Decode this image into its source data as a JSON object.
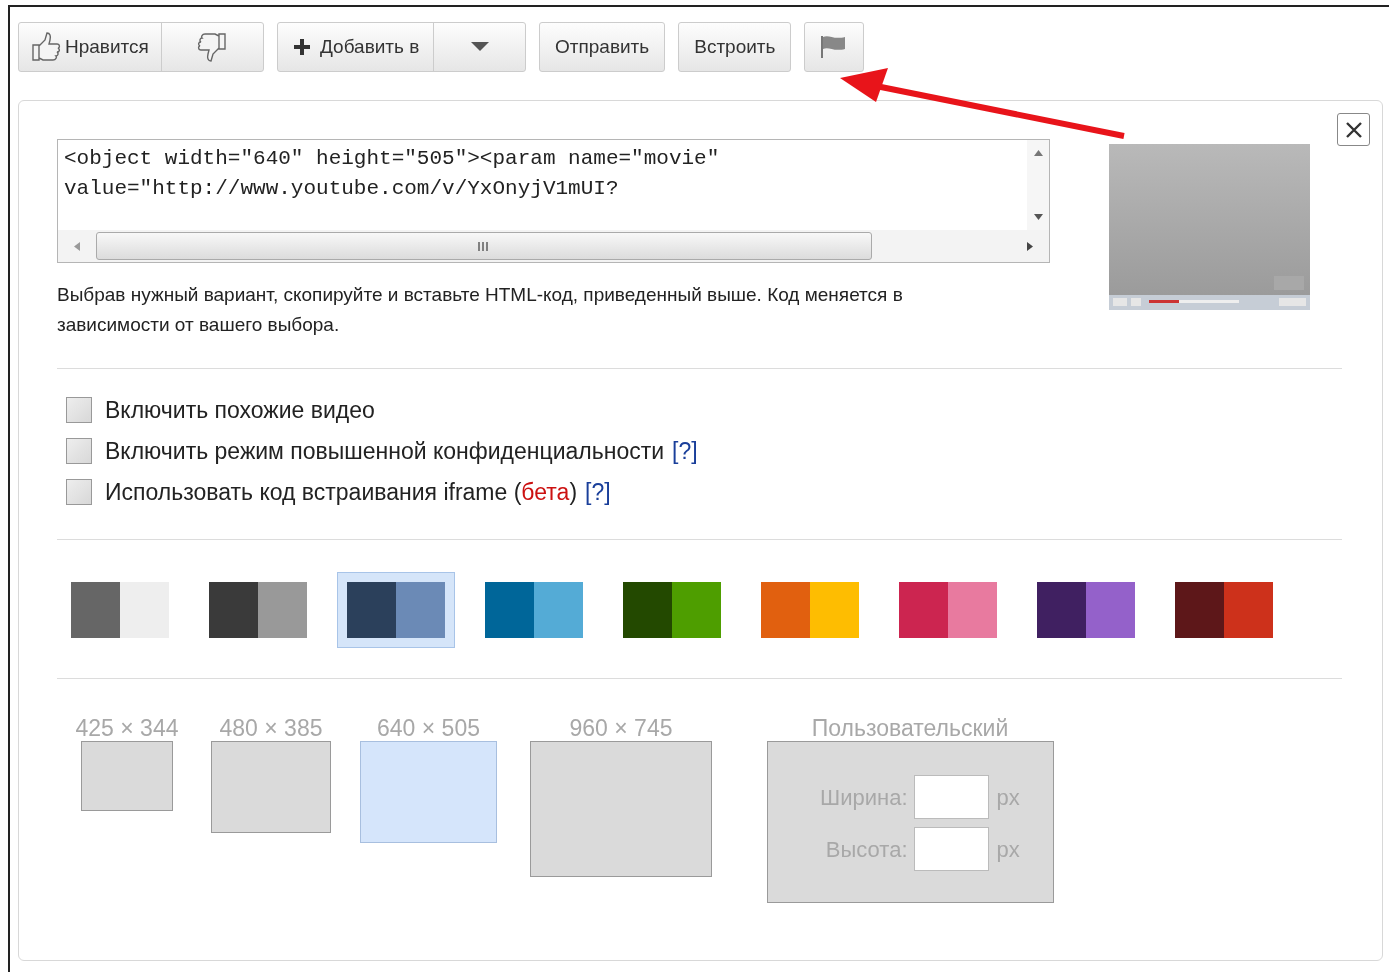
{
  "toolbar": {
    "like": {
      "label": "Нравится"
    },
    "add": {
      "label": "Добавить в"
    },
    "buttons": [
      {
        "label": "Отправить",
        "selected": false
      },
      {
        "label": "Встроить",
        "selected": false
      }
    ]
  },
  "embed_code": {
    "lines": [
      "<object width=\"640\" height=\"505\"><param name=\"movie\"",
      "value=\"http://www.youtube.com/v/YxOnyjV1mUI?"
    ]
  },
  "description": "Выбрав нужный вариант, скопируйте и вставьте HTML-код, приведенный выше. Код меняется в зависимости от вашего выбора.",
  "options": [
    {
      "label": "Включить похожие видео",
      "checked": false
    },
    {
      "label": "Включить режим повышенной конфиденциальности",
      "help": "[?]",
      "checked": false
    },
    {
      "label": "Использовать код встраивания iframe (",
      "beta": "бета",
      "after": ")",
      "help": "[?]",
      "checked": false
    }
  ],
  "swatches": [
    {
      "halves": [
        {
          "color": "#666666"
        },
        {
          "color": "#eeeeee"
        }
      ],
      "selected": false
    },
    {
      "halves": [
        {
          "color": "#3a3a3a"
        },
        {
          "color": "#999999"
        }
      ],
      "selected": false
    },
    {
      "halves": [
        {
          "color": "#2b405b"
        },
        {
          "color": "#6b8ab6"
        }
      ],
      "selected": true
    },
    {
      "halves": [
        {
          "color": "#006699"
        },
        {
          "color": "#54abd6"
        }
      ],
      "selected": false
    },
    {
      "halves": [
        {
          "color": "#234900"
        },
        {
          "color": "#4e9e00"
        }
      ],
      "selected": false
    },
    {
      "halves": [
        {
          "color": "#e1600f"
        },
        {
          "color": "#febd01"
        }
      ],
      "selected": false
    },
    {
      "halves": [
        {
          "color": "#cc2550"
        },
        {
          "color": "#e87a9f"
        }
      ],
      "selected": false
    },
    {
      "halves": [
        {
          "color": "#402061"
        },
        {
          "color": "#9461ca"
        }
      ],
      "selected": false
    },
    {
      "halves": [
        {
          "color": "#5d1719"
        },
        {
          "color": "#cd311b"
        }
      ],
      "selected": false
    }
  ],
  "sizes": [
    {
      "label": "425 × 344",
      "kind": "preset",
      "selected": false
    },
    {
      "label": "480 × 385",
      "kind": "preset",
      "selected": false
    },
    {
      "label": "640 × 505",
      "kind": "preset",
      "selected": true
    },
    {
      "label": "960 × 745",
      "kind": "preset",
      "selected": false
    },
    {
      "label": "Пользовательский",
      "kind": "custom",
      "selected": false,
      "fields": [
        {
          "label": "Ширина:",
          "unit": "px"
        },
        {
          "label": "Высота:",
          "unit": "px"
        }
      ]
    }
  ]
}
